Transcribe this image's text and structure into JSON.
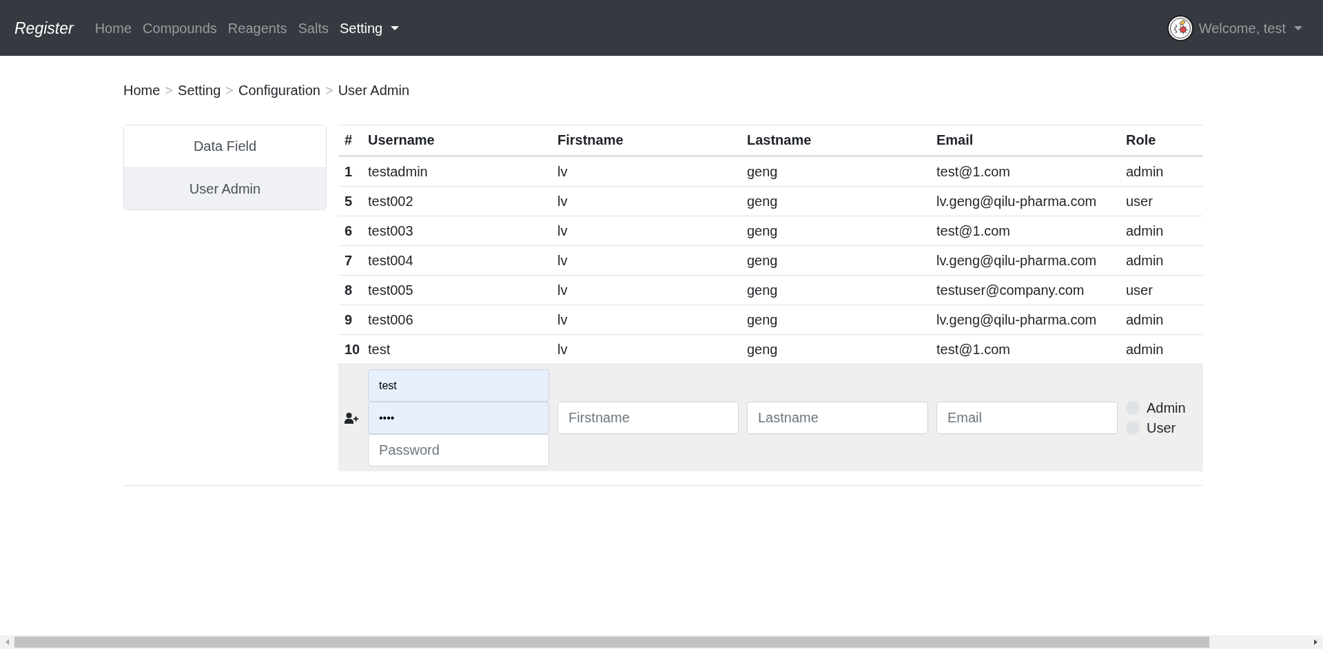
{
  "navbar": {
    "brand": "Register",
    "links": [
      {
        "label": "Home",
        "kind": "link",
        "selected": false
      },
      {
        "label": "Compounds",
        "kind": "link",
        "selected": false
      },
      {
        "label": "Reagents",
        "kind": "link",
        "selected": false
      },
      {
        "label": "Salts",
        "kind": "link",
        "selected": false
      },
      {
        "label": "Setting",
        "kind": "dropdown",
        "selected": true
      }
    ],
    "user_menu": {
      "label": "Welcome, test"
    }
  },
  "breadcrumb": [
    {
      "label": "Home"
    },
    {
      "separator": ">",
      "label": "Setting"
    },
    {
      "separator": ">",
      "label": "Configuration"
    },
    {
      "separator": ">",
      "label": "User Admin"
    }
  ],
  "sidebar": {
    "items": [
      {
        "label": "Data Field",
        "selected": false
      },
      {
        "label": "User Admin",
        "selected": true
      }
    ]
  },
  "table": {
    "columns": [
      "#",
      "Username",
      "Firstname",
      "Lastname",
      "Email",
      "Role"
    ],
    "rows": [
      [
        "1",
        "testadmin",
        "lv",
        "geng",
        "test@1.com",
        "admin"
      ],
      [
        "5",
        "test002",
        "lv",
        "geng",
        "lv.geng@qilu-pharma.com",
        "user"
      ],
      [
        "6",
        "test003",
        "lv",
        "geng",
        "test@1.com",
        "admin"
      ],
      [
        "7",
        "test004",
        "lv",
        "geng",
        "lv.geng@qilu-pharma.com",
        "admin"
      ],
      [
        "8",
        "test005",
        "lv",
        "geng",
        "testuser@company.com",
        "user"
      ],
      [
        "9",
        "test006",
        "lv",
        "geng",
        "lv.geng@qilu-pharma.com",
        "admin"
      ],
      [
        "10",
        "test",
        "lv",
        "geng",
        "test@1.com",
        "admin"
      ]
    ]
  },
  "new_user_row": {
    "account_fields": [
      {
        "value": "test",
        "autofilled": true
      },
      {
        "value": "••••",
        "autofilled": true
      },
      {
        "placeholder": "Password",
        "autofilled": false
      }
    ],
    "firstname": {
      "placeholder": "Firstname"
    },
    "lastname": {
      "placeholder": "Lastname"
    },
    "email": {
      "placeholder": "Email"
    },
    "roles": [
      {
        "label": "Admin",
        "selected": false
      },
      {
        "label": "User",
        "selected": false
      }
    ]
  }
}
